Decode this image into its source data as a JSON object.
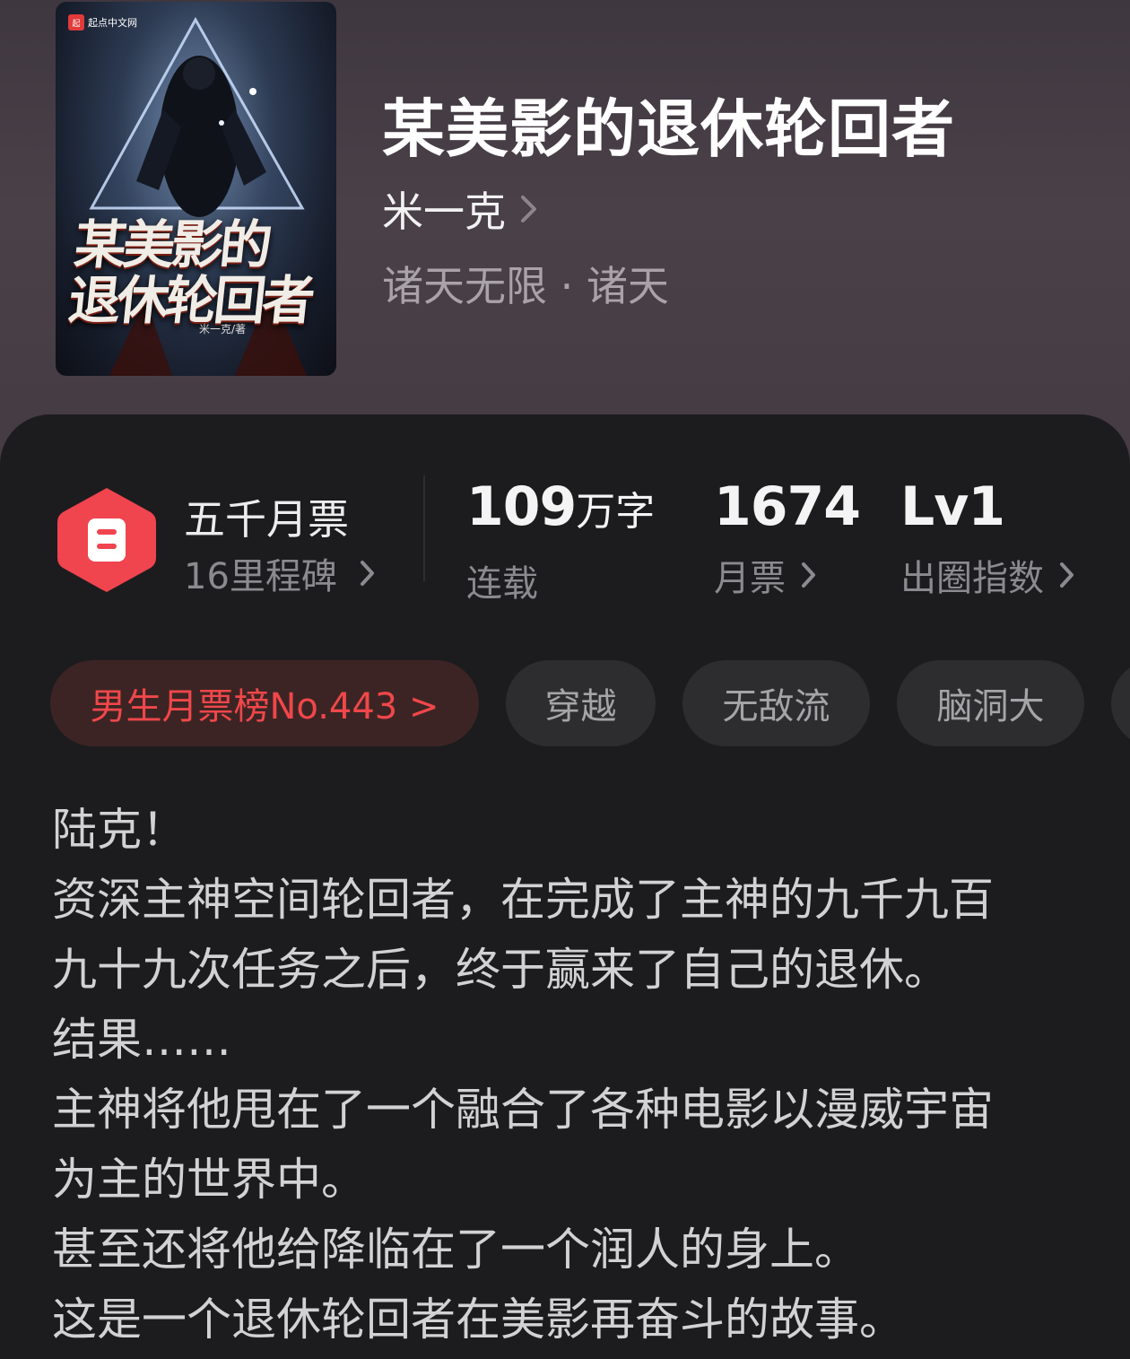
{
  "book": {
    "title": "某美影的退休轮回者",
    "author": "米一克",
    "genre": "诸天无限 · 诸天"
  },
  "cover": {
    "brand": "起点中文网",
    "brand_logo": "起",
    "title_line1": "某美影的",
    "title_line2": "退休轮回者",
    "author_text": "米一克/著"
  },
  "stats": {
    "medal": {
      "title": "五千月票",
      "sub": "16里程碑",
      "icon": "ticket-icon",
      "color": "#f0444e"
    },
    "words": {
      "value": "109",
      "unit": "万字",
      "label": "连载"
    },
    "tickets": {
      "value": "1674",
      "label": "月票"
    },
    "circle": {
      "value": "Lv1",
      "label": "出圈指数"
    }
  },
  "tags": {
    "rank": "男生月票榜No.443 >",
    "items": [
      "穿越",
      "无敌流",
      "脑洞大"
    ]
  },
  "description": [
    "陆克！",
    "资深主神空间轮回者，在完成了主神的九千九百",
    "九十九次任务之后，终于赢来了自己的退休。",
    "结果……",
    "主神将他甩在了一个融合了各种电影以漫威宇宙",
    "为主的世界中。",
    "甚至还将他给降临在了一个润人的身上。",
    "这是一个退休轮回者在美影再奋斗的故事。"
  ],
  "colors": {
    "accent_red": "#f0474a",
    "background": "#1c1c1e",
    "header_bg": "#453b43"
  }
}
